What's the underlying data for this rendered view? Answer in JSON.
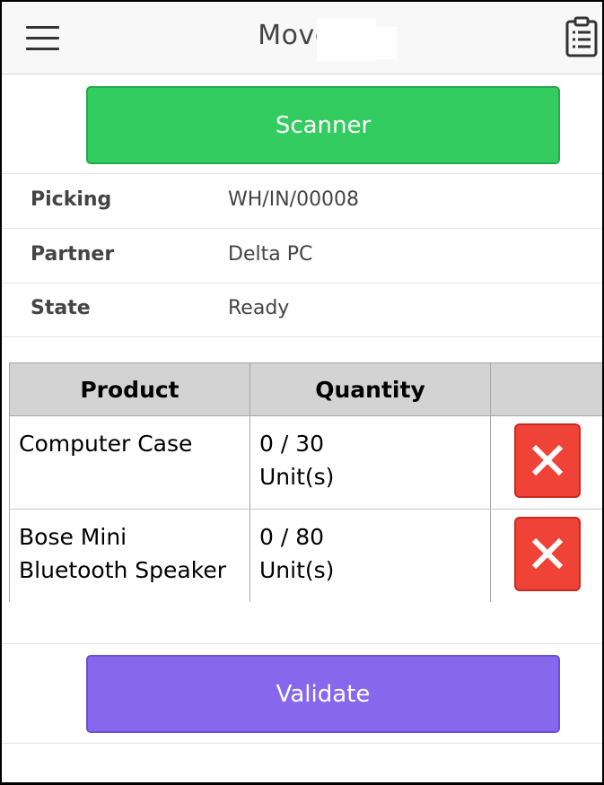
{
  "header": {
    "title": "Moves",
    "menu_icon": "hamburger-menu-icon",
    "clipboard_icon": "clipboard-list-icon"
  },
  "actions": {
    "scanner_label": "Scanner",
    "validate_label": "Validate",
    "scanner_color": "#33cc60",
    "validate_color": "#8768ed",
    "delete_color": "#ef4338"
  },
  "info": {
    "picking_label": "Picking",
    "picking_value": "WH/IN/00008",
    "partner_label": "Partner",
    "partner_value": "Delta PC",
    "state_label": "State",
    "state_value": "Ready"
  },
  "table": {
    "headers": [
      "Product",
      "Quantity",
      ""
    ],
    "rows": [
      {
        "product": "Computer Case",
        "quantity": "0 / 30",
        "unit": "Unit(s)",
        "delete_icon": "close-x-icon"
      },
      {
        "product": "Bose Mini Bluetooth Speaker",
        "quantity": "0 / 80",
        "unit": "Unit(s)",
        "delete_icon": "close-x-icon"
      }
    ]
  }
}
